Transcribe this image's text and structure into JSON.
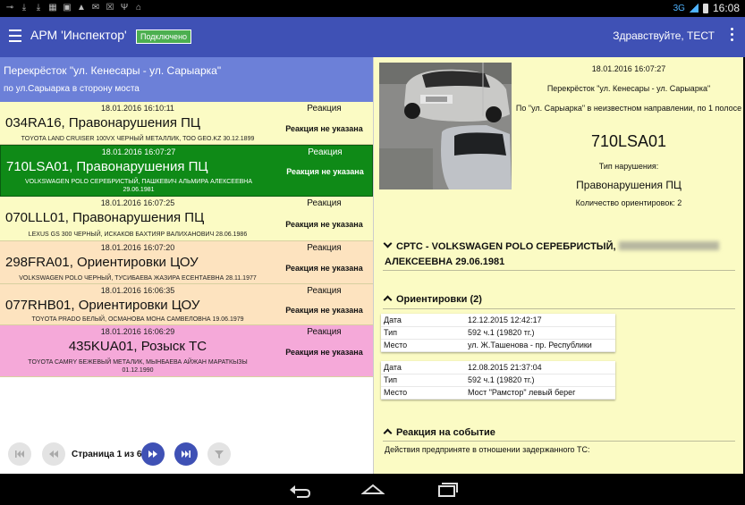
{
  "status_bar": {
    "network": "3G",
    "time": "16:08"
  },
  "app": {
    "title": "АРМ 'Инспектор'",
    "connection": "Подключено",
    "greeting": "Здравствуйте, ТЕСТ"
  },
  "location": {
    "title": "Перекрёсток \"ул. Кенесары - ул. Сарыарка\"",
    "direction": "по ул.Сарыарка в сторону моста"
  },
  "events": [
    {
      "time": "18.01.2016 16:10:11",
      "title": "034RA16, Правонарушения ПЦ",
      "desc": "TOYOTA LAND CRUISER 100VX ЧЕРНЫЙ МЕТАЛЛИК, ТОО GEO.KZ 30.12.1899",
      "reaction_label": "Реакция",
      "reaction": "Реакция не указана",
      "color": "#fbfbc4",
      "selected": false
    },
    {
      "time": "18.01.2016 16:07:27",
      "title": "710LSA01, Правонарушения ПЦ",
      "desc": "VOLKSWAGEN POLO СЕРЕБРИСТЫЙ, ПАШКЕВИЧ АЛЬМИРА АЛЕКСЕЕВНА 29.06.1981",
      "reaction_label": "Реакция",
      "reaction": "Реакция не указана",
      "color": "#0f8a17",
      "selected": true
    },
    {
      "time": "18.01.2016 16:07:25",
      "title": "070LLL01, Правонарушения ПЦ",
      "desc": "LEXUS GS 300 ЧЕРНЫЙ, ИСКАКОВ БАХТИЯР ВАЛИХАНОВИЧ 28.06.1986",
      "reaction_label": "Реакция",
      "reaction": "Реакция не указана",
      "color": "#fbfbc4",
      "selected": false
    },
    {
      "time": "18.01.2016 16:07:20",
      "title": "298FRA01, Ориентировки ЦОУ",
      "desc": "VOLKSWAGEN POLO ЧЕРНЫЙ, ТУСИБАЕВА ЖАЗИРА ЕСЕНТАЕВНА 28.11.1977",
      "reaction_label": "Реакция",
      "reaction": "Реакция не указана",
      "color": "#fde3bf",
      "selected": false
    },
    {
      "time": "18.01.2016 16:06:35",
      "title": "077RHB01, Ориентировки ЦОУ",
      "desc": "TOYOTA PRADO БЕЛЫЙ, ОСМАНОВА МОНА САМВЕЛОВНА 19.06.1979",
      "reaction_label": "Реакция",
      "reaction": "Реакция не указана",
      "color": "#fde3bf",
      "selected": false
    },
    {
      "time": "18.01.2016 16:06:29",
      "title": "435KUA01, Розыск ТС",
      "desc": "TOYOTA CAMRY БЕЖЕВЫЙ МЕТАЛИК, МЫНБАЕВА АЙЖАН МАРАТКЫЗЫ 01.12.1990",
      "reaction_label": "Реакция",
      "reaction": "Реакция не указана",
      "color": "#f5a9d9",
      "selected": false
    }
  ],
  "pager": {
    "label": "Страница 1 из 6"
  },
  "detail": {
    "date": "18.01.2016 16:07:27",
    "intersection": "Перекрёсток \"ул. Кенесары - ул. Сарыарка\"",
    "direction": "По \"ул. Сарыарка\" в неизвестном направлении, по 1 полосе",
    "plate": "710LSA01",
    "type_label": "Тип нарушения:",
    "type": "Правонарушения ПЦ",
    "count": "Количество ориентировок: 2",
    "srts_part1": "СРТС - VOLKSWAGEN POLO СЕРЕБРИСТЫЙ,",
    "srts_part2": "АЛЕКСЕЕВНА 29.06.1981",
    "orientations_title": "Ориентировки (2)",
    "orientations": [
      {
        "date_label": "Дата",
        "date": "12.12.2015 12:42:17",
        "type_label": "Тип",
        "type": "592 ч.1 (19820 тг.)",
        "place_label": "Место",
        "place": "ул. Ж.Ташенова - пр. Республики"
      },
      {
        "date_label": "Дата",
        "date": "12.08.2015 21:37:04",
        "type_label": "Тип",
        "type": "592 ч.1 (19820 тг.)",
        "place_label": "Место",
        "place": "Мост \"Рамстор\" левый берег"
      }
    ],
    "reaction_title": "Реакция на событие",
    "reaction_text": "Действия предприняте в отношении задержанного ТС:"
  }
}
